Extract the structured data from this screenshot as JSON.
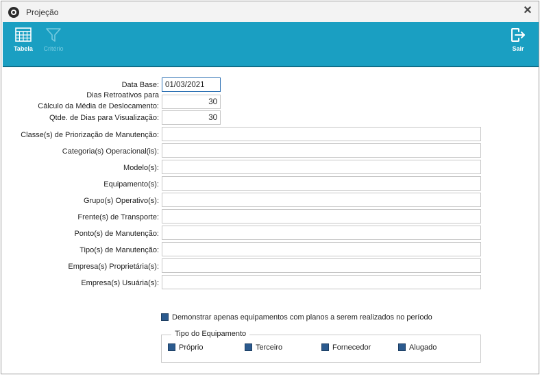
{
  "window": {
    "title": "Projeção",
    "close_glyph": "✕"
  },
  "toolbar": {
    "tabela_label": "Tabela",
    "criterio_label": "Critério",
    "sair_label": "Sair",
    "background_color": "#1a9fc2"
  },
  "form": {
    "data_base": {
      "label": "Data Base:",
      "value": "01/03/2021"
    },
    "dias_retroativos": {
      "label_line1": "Dias Retroativos para",
      "label_line2": "Cálculo da Média de Deslocamento:",
      "value": "30"
    },
    "qtde_dias": {
      "label": "Qtde. de Dias para Visualização:",
      "value": "30"
    },
    "classes": {
      "label": "Classe(s) de Priorização de Manutenção:",
      "value": ""
    },
    "categorias": {
      "label": "Categoria(s) Operacional(is):",
      "value": ""
    },
    "modelos": {
      "label": "Modelo(s):",
      "value": ""
    },
    "equipamentos": {
      "label": "Equipamento(s):",
      "value": ""
    },
    "grupos": {
      "label": "Grupo(s) Operativo(s):",
      "value": ""
    },
    "frentes": {
      "label": "Frente(s) de Transporte:",
      "value": ""
    },
    "pontos": {
      "label": "Ponto(s) de Manutenção:",
      "value": ""
    },
    "tipos": {
      "label": "Tipo(s) de Manutenção:",
      "value": ""
    },
    "empresas_proprietarias": {
      "label": "Empresa(s) Proprietária(s):",
      "value": ""
    },
    "empresas_usuarias": {
      "label": "Empresa(s) Usuária(s):",
      "value": ""
    }
  },
  "options": {
    "demonstrar_label": "Demonstrar apenas equipamentos com planos a serem realizados no período",
    "demonstrar_checked": true
  },
  "tipo_equipamento": {
    "title": "Tipo do Equipamento",
    "items": [
      {
        "label": "Próprio",
        "checked": true
      },
      {
        "label": "Terceiro",
        "checked": true
      },
      {
        "label": "Fornecedor",
        "checked": true
      },
      {
        "label": "Alugado",
        "checked": true
      }
    ]
  }
}
